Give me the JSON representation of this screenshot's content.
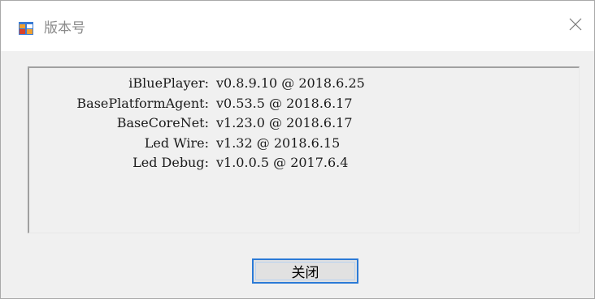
{
  "window": {
    "title": "版本号",
    "icon": "app-window-icon",
    "close_icon": "close-icon"
  },
  "versions": [
    {
      "name": "iBluePlayer:",
      "version": "v0.8.9.10 @ 2018.6.25"
    },
    {
      "name": "BasePlatformAgent:",
      "version": "v0.53.5 @ 2018.6.17"
    },
    {
      "name": "BaseCoreNet:",
      "version": "v1.23.0 @ 2018.6.17"
    },
    {
      "name": "Led Wire:",
      "version": "v1.32 @ 2018.6.15"
    },
    {
      "name": "Led Debug:",
      "version": "v1.0.0.5 @ 2017.6.4"
    }
  ],
  "buttons": {
    "close_label": "关闭"
  },
  "colors": {
    "focus_border": "#2b7ad6",
    "icon_blue": "#3a7bd5",
    "icon_orange": "#f0a030",
    "icon_red": "#d9412b"
  }
}
